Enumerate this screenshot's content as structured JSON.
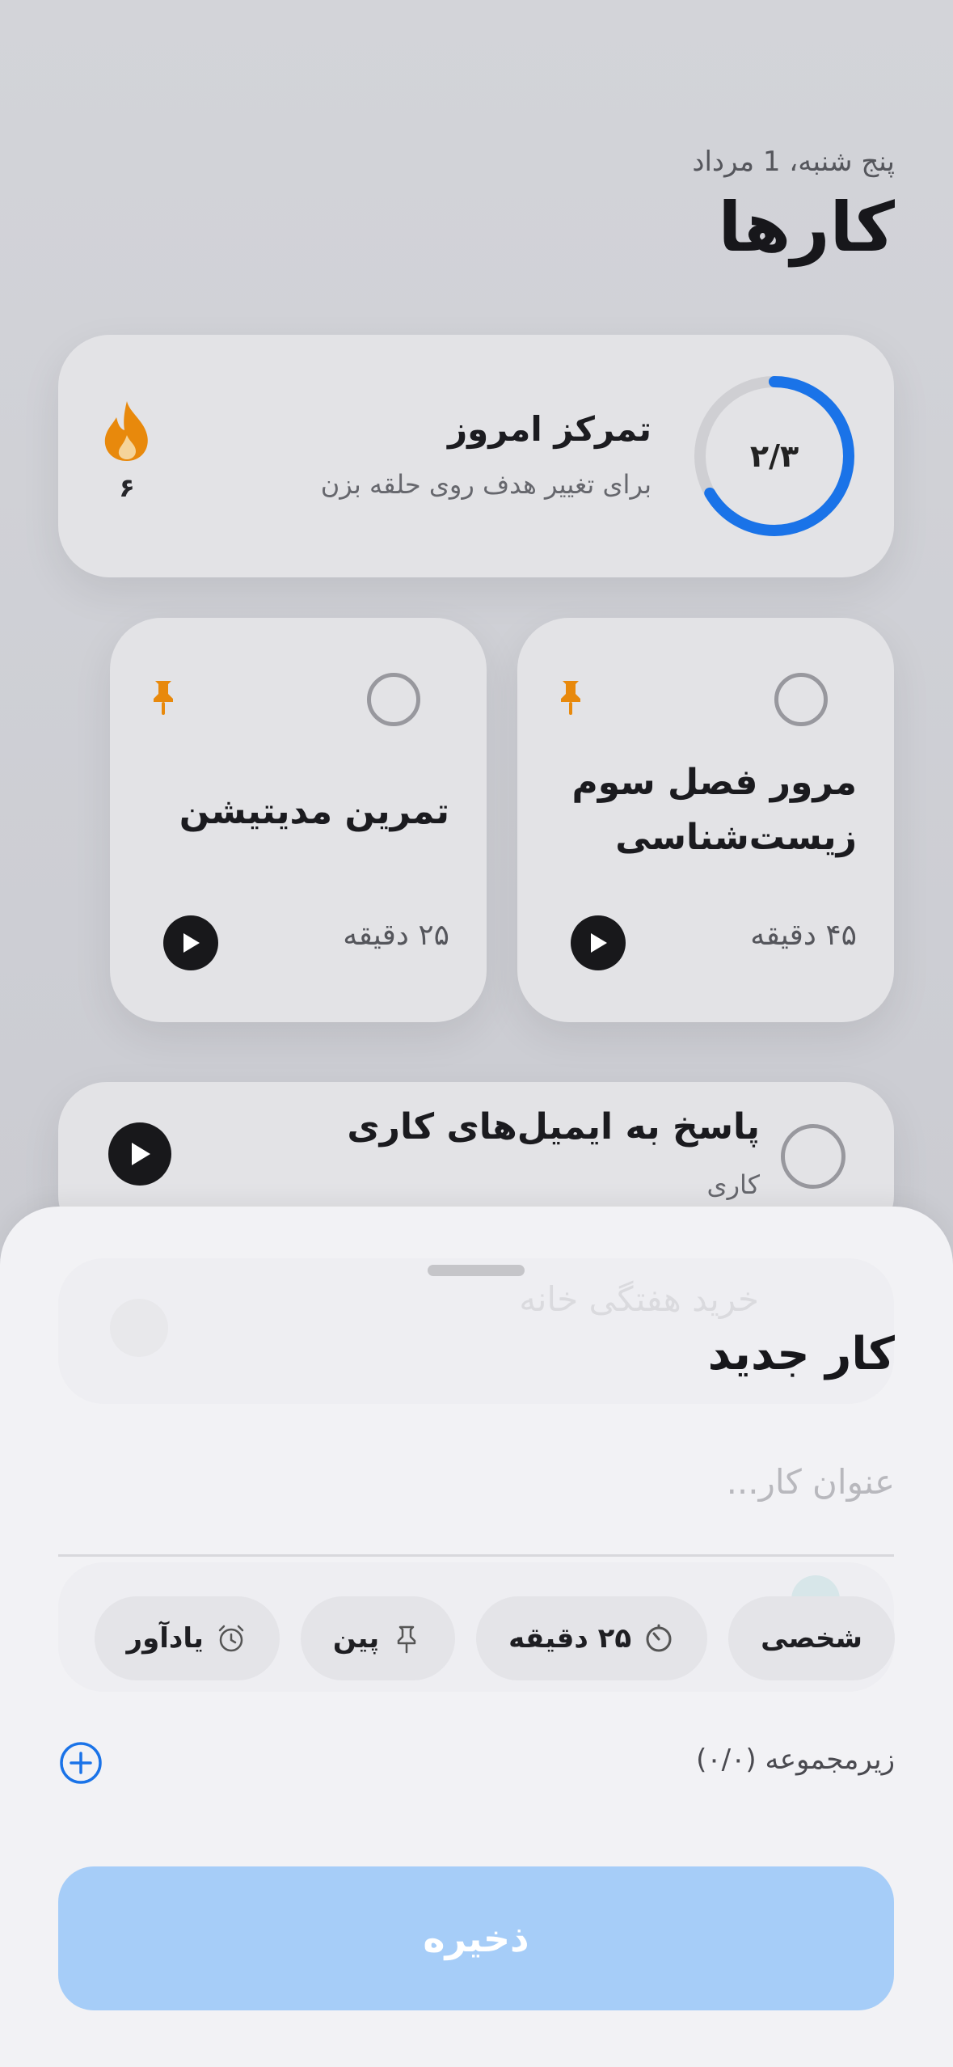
{
  "header": {
    "date": "پنج شنبه، 1 مرداد",
    "title": "کارها"
  },
  "focus": {
    "ring_label": "۲/۳",
    "ring_progress": 0.6667,
    "title": "تمرکز امروز",
    "subtitle": "برای تغییر هدف روی حلقه بزن",
    "streak_count": "۶",
    "accent": "#1a73e8",
    "streak_color": "#e8890c"
  },
  "tiles": [
    {
      "title": "مرور فصل سوم زیست‌شناسی",
      "duration": "۴۵ دقیقه",
      "pinned": true
    },
    {
      "title": "تمرین مدیتیشن",
      "duration": "۲۵ دقیقه",
      "pinned": true
    }
  ],
  "list": [
    {
      "title": "پاسخ به ایمیل‌های کاری",
      "tag": "کاری"
    }
  ],
  "sheet": {
    "title": "کار جدید",
    "input_placeholder": "عنوان کار...",
    "chips": {
      "category": "شخصی",
      "duration": "۲۵ دقیقه",
      "pin": "پین",
      "reminder": "یادآور"
    },
    "subtasks_label": "زیرمجموعه (۰/۰)",
    "save_label": "ذخیره",
    "save_color": "#a6cdf8"
  },
  "background_ghost": {
    "row_title": "خرید هفتگی خانه"
  }
}
